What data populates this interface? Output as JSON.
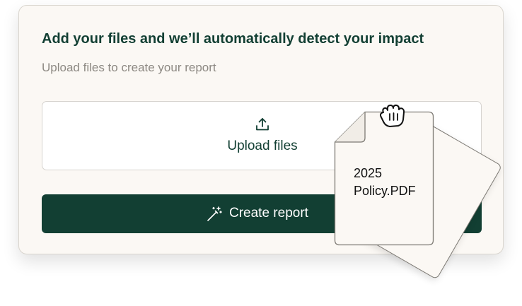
{
  "card": {
    "title": "Add your files and we’ll automatically detect your impact",
    "subtitle": "Upload files to create your report"
  },
  "upload": {
    "label": "Upload files",
    "icon": "upload-icon"
  },
  "create": {
    "label": "Create report",
    "icon": "magic-wand-icon"
  },
  "dragged_file": {
    "name": "2025 Policy.PDF",
    "icon": "document-icon"
  },
  "cursor": {
    "icon": "grab-hand-cursor-icon"
  },
  "colors": {
    "brand_dark_green": "#123f33",
    "card_background": "#fbf8f4",
    "muted_text": "#8d8983"
  }
}
